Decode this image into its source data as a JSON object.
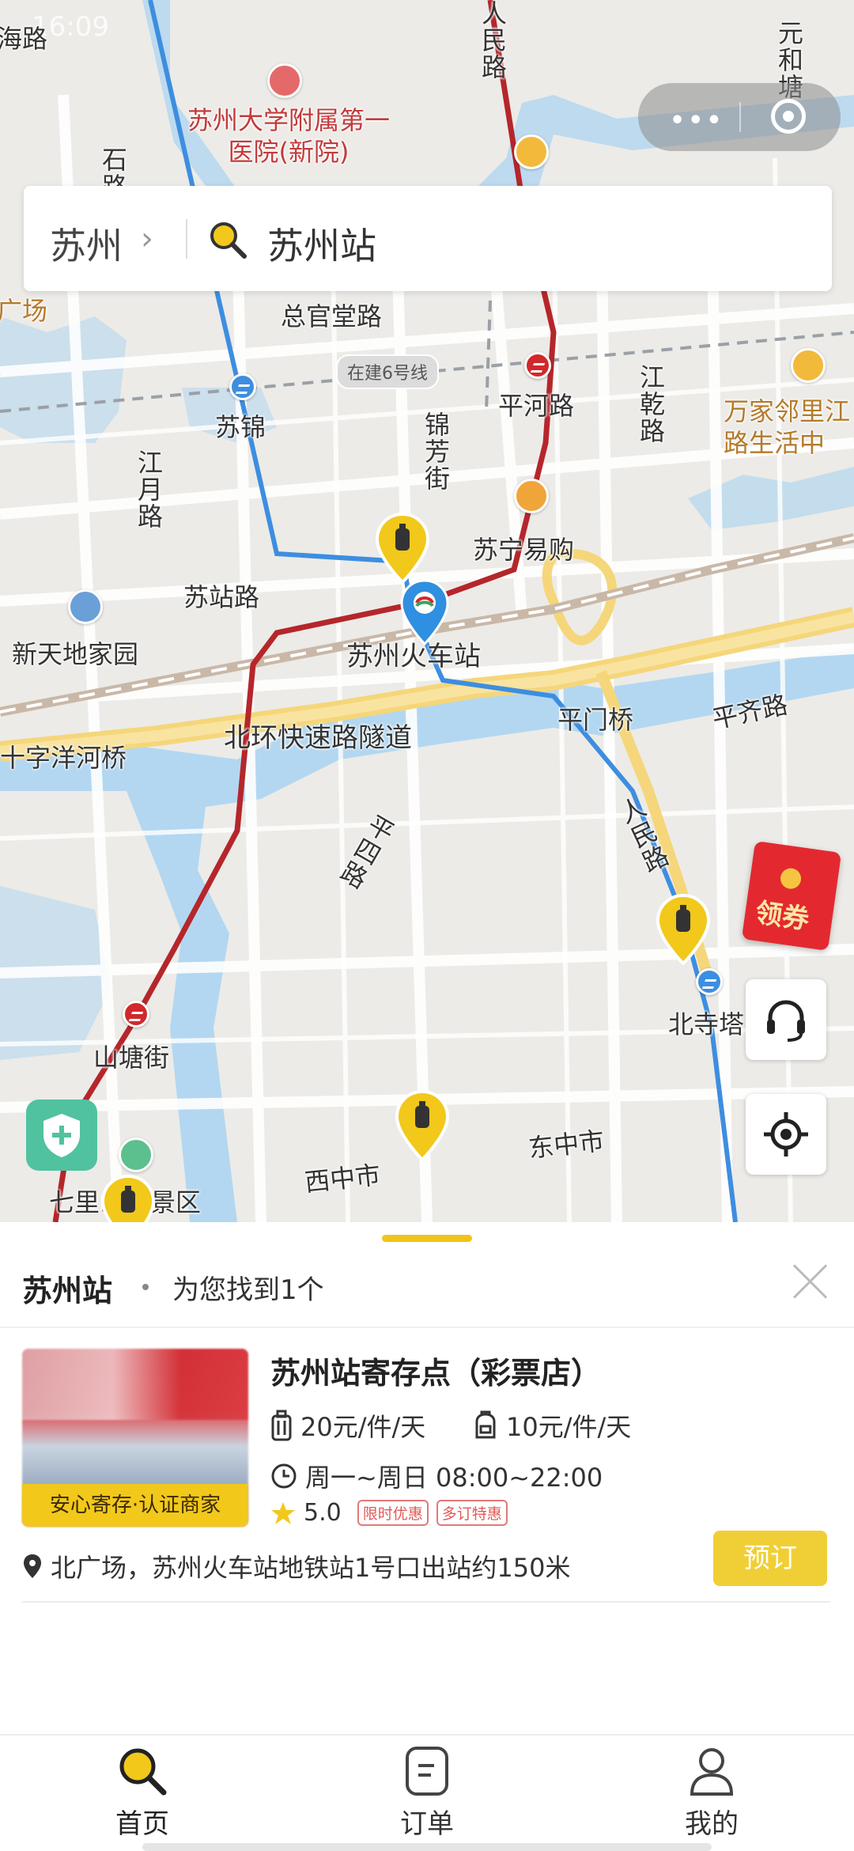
{
  "status_bar": {
    "time": "16:09"
  },
  "search": {
    "city": "苏州",
    "query": "苏州站"
  },
  "map": {
    "labels": {
      "hospital": "苏州大学附属第一医院(新院)",
      "zongguantang": "总官堂路",
      "line6": "在建6号线",
      "sujin": "苏锦",
      "pinghe": "平河路",
      "jiangqian": "江乾路",
      "wanjia": "万家邻里江路生活中",
      "jiangyue": "江月路",
      "jinfang": "锦芳街",
      "suning": "苏宁易购",
      "suzhan_rd": "苏站路",
      "xintiandi": "新天地家园",
      "station": "苏州火车站",
      "pingmen": "平门桥",
      "pingqi": "平齐路",
      "shiziyanghe": "十字洋河桥",
      "beihuan": "北环快速路隧道",
      "pingsi": "平四路",
      "renmin": "人民路",
      "beisita": "北寺塔",
      "shantangjie": "山塘街",
      "dongzhongshi": "东中市",
      "xizhongshi": "西中市",
      "qili": "七里山塘景区",
      "renmin_top": "人民路",
      "yuanhetang": "元和塘",
      "haixi": "海路",
      "guangchang": "广场",
      "sichuan": "石路"
    },
    "coupon_label": "领券"
  },
  "panel": {
    "title": "苏州站",
    "subtitle": "为您找到1个",
    "result": {
      "name": "苏州站寄存点（彩票店）",
      "price_large": "20元/件/天",
      "price_small": "10元/件/天",
      "hours": "周一~周日 08:00~22:00",
      "rating": "5.0",
      "tags": [
        "限时优惠",
        "多订特惠"
      ],
      "thumb_tag": "安心寄存·认证商家",
      "address": "北广场，苏州火车站地铁站1号口出站约150米",
      "book_label": "预订"
    }
  },
  "tabs": [
    {
      "label": "首页",
      "icon": "search-icon",
      "active": true
    },
    {
      "label": "订单",
      "icon": "order-icon",
      "active": false
    },
    {
      "label": "我的",
      "icon": "user-icon",
      "active": false
    }
  ],
  "colors": {
    "accent": "#f1c418",
    "metro_red": "#d1282b",
    "metro_blue": "#3d8ee0",
    "water": "#a9d3f2",
    "expressway": "#f5d67a"
  }
}
